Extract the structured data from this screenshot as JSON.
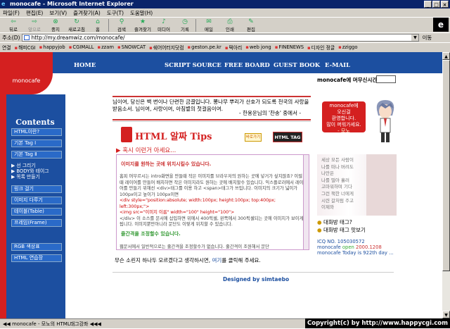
{
  "window": {
    "title": "monocafe - Microsoft Internet Explorer",
    "controls": [
      "_",
      "□",
      "×"
    ]
  },
  "menu": [
    "파일(F)",
    "편집(E)",
    "보기(V)",
    "즐겨찾기(A)",
    "도구(T)",
    "도움말(H)"
  ],
  "toolbar": [
    {
      "label": "뒤로",
      "icon": "back-arrow-icon",
      "glyph": "⇦"
    },
    {
      "label": "앞으로",
      "icon": "forward-arrow-icon",
      "glyph": "⇨"
    },
    {
      "label": "중지",
      "icon": "stop-icon",
      "glyph": "⊗"
    },
    {
      "label": "새로고침",
      "icon": "refresh-icon",
      "glyph": "↻"
    },
    {
      "label": "홈",
      "icon": "home-icon",
      "glyph": "⌂"
    },
    {
      "label": "검색",
      "icon": "search-icon",
      "glyph": "⚲"
    },
    {
      "label": "즐겨찾기",
      "icon": "favorites-icon",
      "glyph": "★"
    },
    {
      "label": "미디어",
      "icon": "media-icon",
      "glyph": "♪"
    },
    {
      "label": "기록",
      "icon": "history-icon",
      "glyph": "◷"
    },
    {
      "label": "메일",
      "icon": "mail-icon",
      "glyph": "✉"
    },
    {
      "label": "인쇄",
      "icon": "print-icon",
      "glyph": "⎙"
    },
    {
      "label": "편집",
      "icon": "edit-icon",
      "glyph": "✎"
    }
  ],
  "address": {
    "label": "주소(D)",
    "url": "http://my.dreamwiz.com/monocafe/",
    "go": "이동"
  },
  "links": {
    "label": "연결",
    "items": [
      "해피CGI",
      "happyjob",
      "CGIMALL",
      "zzam",
      "SNOWCAT",
      "쉐어어터지닷컴",
      "geston.pe.kr",
      "떡아리",
      "web jong",
      "FINENEWS",
      "디자인 정글",
      "zziggo"
    ]
  },
  "page": {
    "logo": "monocafe",
    "nav": [
      "HOME",
      "SCRIPT SOURCE",
      "FREE BOARD",
      "GUEST BOOK",
      "E-MAIL"
    ],
    "visit_label": "monocafe에 머무신시간",
    "contents_title": "Contents",
    "side_items": [
      "HTML이란?",
      "기본 Tag Ⅰ",
      "기본 Tag Ⅱ"
    ],
    "side_sub": [
      "▶ 선 그리기",
      "▶ BODY와 테이그",
      "▶ 목록 만들기"
    ],
    "side_items2": [
      "링크 걸기",
      "이미지 다루기",
      "테이블(Table)",
      "프레임(Frame)",
      "RGB 색상표",
      "HTML 연습장"
    ],
    "quote": "님이여, 당신은 백 번이나 단련한 금결입니다. 뽕나무 뿌리가 산호가 되도록 천국의 사랑을 받음소서. 님이여, 사랑이여, 아침볕의 첫걸음이여.",
    "quote_src": "- 한용운님의 '찬송' 중에서 -",
    "bubble": [
      "monocafe에",
      "오신걸",
      "환영합니다.",
      "많이 퍼워가세요.",
      "- 모노"
    ],
    "tips_title": "HTML 알짜 Tips",
    "tips_btn1": "바로가기",
    "tips_btn2": "HTML TAG",
    "tips_sub": "▶ 혹시 이런거 아세요...",
    "panel_head": "이미지를 원하는 곳에 위치시킬수 있습니다.",
    "panel_body": "홈피 머무르시는 intro화면을 만들때 작은 이미지를 브라우저의 원하는 곳에 넣거가 싶지않죠? 이럴때 레이어를 만들어 배치하면 작은 이미지라도 원하는 곳에 배치할수 있습니다. 익스플로러에서 레이어를 만들기 위해선 <div>태그를 이용 하고 <span>태그가 쓰입니다. 이미지의 크기가 넓이가 100px이고 높이가 100px이면",
    "panel_code1": "<div style=\"position:absolute; width:100px; height:100px; top:400px; left:300px;\">",
    "panel_code2": "<img src=\"이미지 이름\" width=\"100\" height=\"100\">",
    "panel_body_end": "</div> 이 소스를 문서에 삽입하면 위에서 400픽셀, 왼쪽에서 300픽셀되는 곳에 이미지가 보이게 됩니다. 이미지뿐만아니라 문단도 이렇게 위치할 수 있습니다.",
    "panel_head2": "줄간격을 조정할수 있습니다.",
    "panel_body2": "웹문서에서 일반적으로는 줄간격을 조정할수가 없습니다. 줄간격이 조원해서 문단",
    "note_pre": "무슨 소린지 하나두 모르겠다고 생각하시면, ",
    "note_link": "여기",
    "note_post": "를 클릭해 주세요.",
    "credit": "Designed by simtaebo",
    "photo_text": [
      "세상 모든 사람이",
      "나를 떠나 버려도",
      "나만은",
      "나를 떨아 흘러",
      "고마워하며 기다",
      "",
      "그런 책한 너에게",
      "시련 갈처럼 주고",
      "이제와"
    ],
    "rlinks": [
      "대화방 태그?",
      "대화방 태그 맛보기"
    ],
    "icq": {
      "line1": "ICQ NO. 105030572",
      "line2_a": "monocafe ",
      "line2_b": "open ",
      "line2_c": "2000.1208",
      "line3_a": "monocafe ",
      "line3_b": "Today is 922th day ..."
    }
  },
  "status": {
    "text": "◀◀ monocafe - 모노의 HTML태그강좌 ◀◀◀",
    "copyright": "Copyright(c) by http://www.happycgi.com"
  }
}
